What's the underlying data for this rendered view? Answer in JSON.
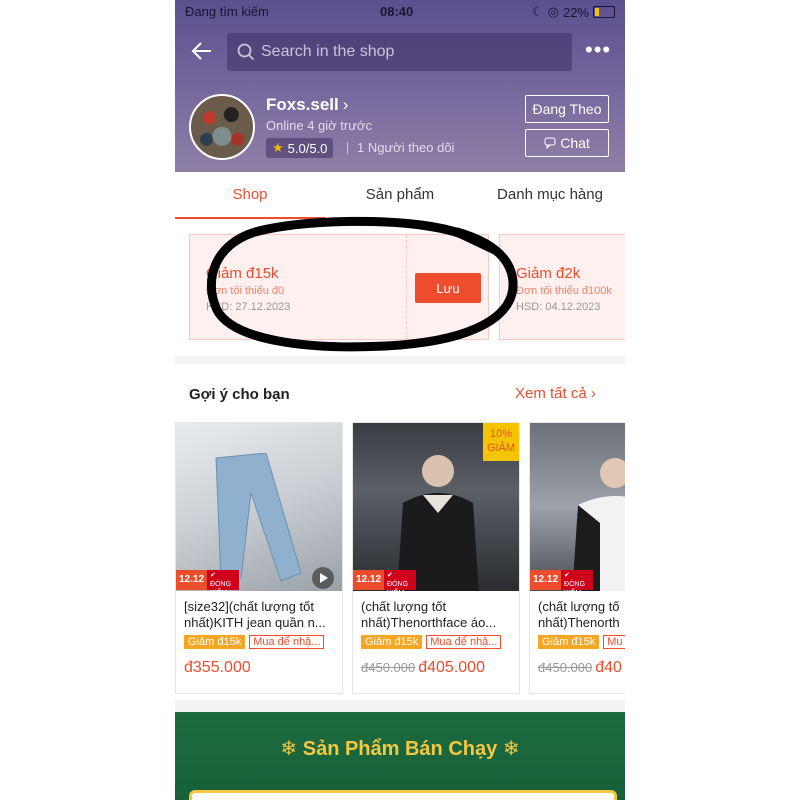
{
  "status_bar": {
    "carrier": "Đang tìm kiếm",
    "time": "08:40",
    "battery": "22%",
    "battery_level": 0.22
  },
  "search": {
    "placeholder": "Search in the shop"
  },
  "shop": {
    "name": "Foxs.sell",
    "online": "Online 4 giờ trước",
    "rating": "5.0/5.0",
    "followers": "1 Người theo dõi",
    "follow_label": "Đang Theo",
    "chat_label": "Chat"
  },
  "tabs": [
    {
      "label": "Shop"
    },
    {
      "label": "Sản phẩm"
    },
    {
      "label": "Danh mục hàng"
    }
  ],
  "vouchers": [
    {
      "title": "Giảm đ15k",
      "min": "Đơn tối thiểu đ0",
      "expiry": "HSD: 27.12.2023",
      "button": "Lưu"
    },
    {
      "title": "Giảm đ2k",
      "min": "Đơn tối thiểu đ100k",
      "expiry": "HSD: 04.12.2023"
    }
  ],
  "recommendations": {
    "title": "Gợi ý cho bạn",
    "see_all": "Xem tất cả",
    "products": [
      {
        "name": "[size32](chất lượng tốt nhất)KITH jean quần n...",
        "discount_tag": "Giảm đ15k",
        "buy_tag": "Mua để nhậ...",
        "old_price": "",
        "price": "đ355.000",
        "badge": "12.12"
      },
      {
        "name": "(chất lượng tốt nhất)Thenorthface áo...",
        "discount_tag": "Giảm đ15k",
        "buy_tag": "Mua để nhậ...",
        "old_price": "đ450.000",
        "price": "đ405.000",
        "badge": "12.12",
        "corner": "10% GIẢM"
      },
      {
        "name": "(chất lượng tố nhất)Thenorth",
        "discount_tag": "Giảm đ15k",
        "buy_tag": "Mu",
        "old_price": "đ450.000",
        "price": "đ40",
        "badge": "12.12"
      }
    ]
  },
  "best_sellers": {
    "title": "Sản Phẩm Bán Chạy"
  },
  "colors": {
    "brand": "#ee4d2d",
    "header": "#6b5e98",
    "best_seller_bg": "#1e6b3f",
    "annotation": "#000000"
  }
}
